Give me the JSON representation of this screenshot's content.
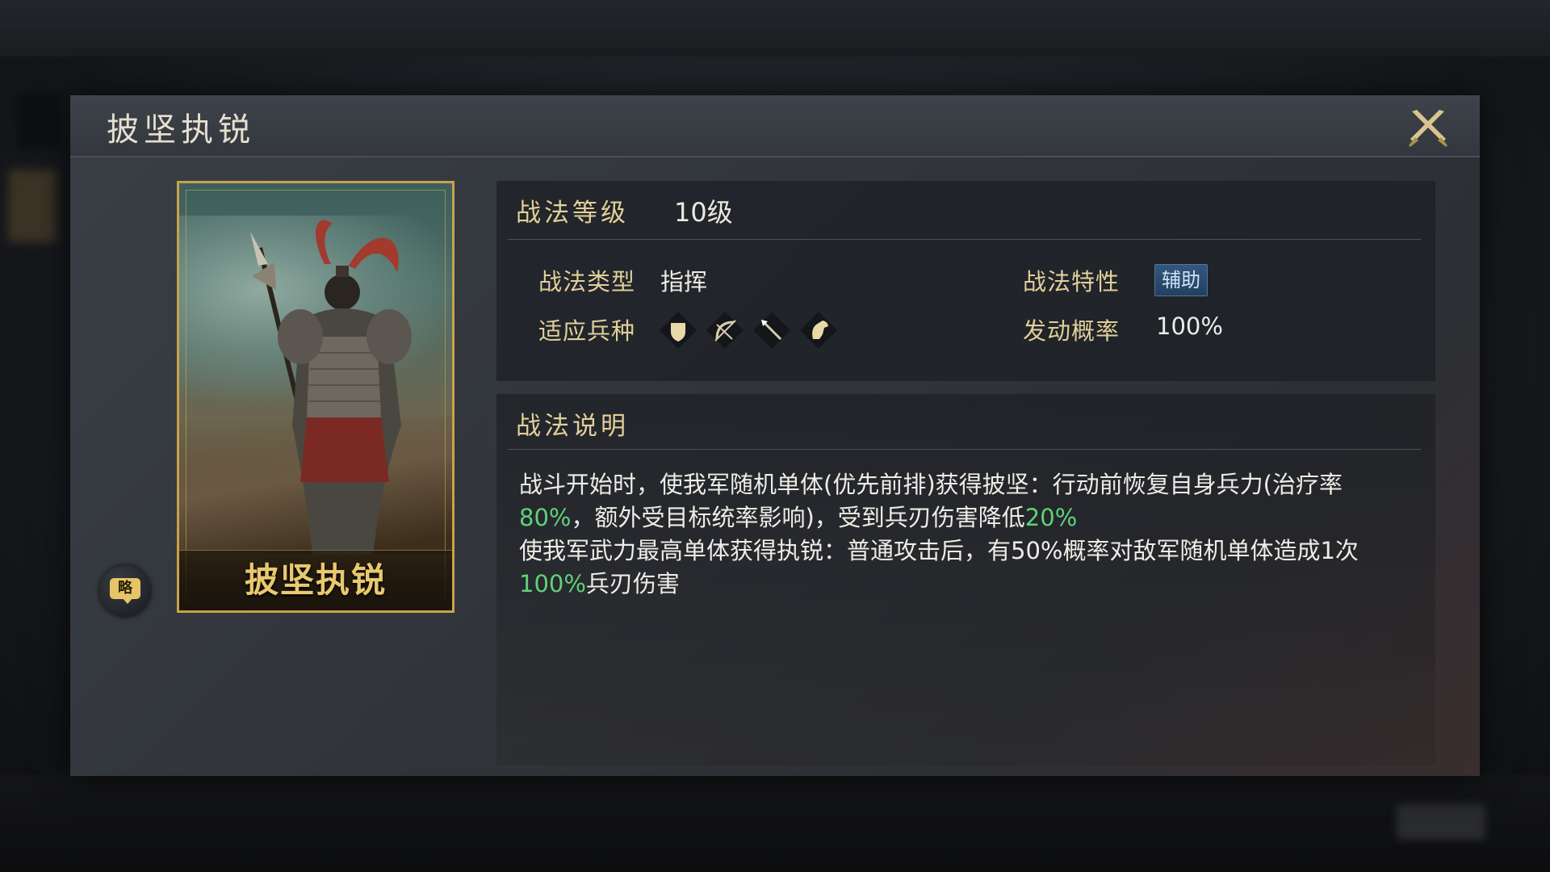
{
  "dialog": {
    "title": "披坚执锐",
    "close_icon": "close-crossed-blades-icon"
  },
  "card": {
    "name": "披坚执锐",
    "strategy_button_label": "略"
  },
  "info": {
    "level_label": "战法等级",
    "level_value": "10级",
    "type_label": "战法类型",
    "type_value": "指挥",
    "trait_label": "战法特性",
    "trait_value": "辅助",
    "troops_label": "适应兵种",
    "troop_icons": [
      "shield-icon",
      "bow-icon",
      "spear-icon",
      "horse-icon"
    ],
    "rate_label": "发动概率",
    "rate_value": "100%"
  },
  "description": {
    "title": "战法说明",
    "segments": [
      {
        "text": "战斗开始时，使我军随机单体(优先前排)获得披坚：行动前恢复自身兵力(治疗率",
        "highlight": false
      },
      {
        "text": "80%",
        "highlight": true
      },
      {
        "text": "，额外受目标统率影响)，受到兵刃伤害降低",
        "highlight": false
      },
      {
        "text": "20%",
        "highlight": true
      },
      {
        "text": "\n使我军武力最高单体获得执锐：普通攻击后，有50%概率对敌军随机单体造成1次",
        "highlight": false
      },
      {
        "text": "100%",
        "highlight": true
      },
      {
        "text": "兵刃伤害",
        "highlight": false
      }
    ]
  },
  "colors": {
    "gold_label": "#e1cf9a",
    "highlight_green": "#5fd17a",
    "card_border": "#c9a24a",
    "badge_blue": "#35577d"
  }
}
